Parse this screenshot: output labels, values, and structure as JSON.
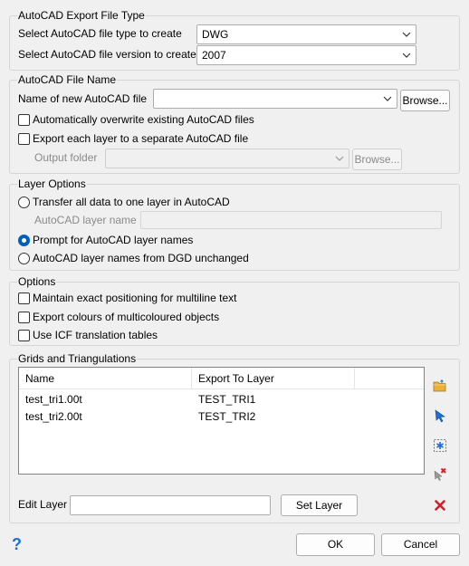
{
  "export_type": {
    "title": "AutoCAD Export File Type",
    "file_type_label": "Select AutoCAD file type to create",
    "file_type_value": "DWG",
    "version_label": "Select AutoCAD file version to create",
    "version_value": "2007"
  },
  "file_name": {
    "title": "AutoCAD File Name",
    "name_label": "Name of new AutoCAD file",
    "name_value": "",
    "browse_label": "Browse...",
    "overwrite_label": "Automatically overwrite existing AutoCAD files",
    "overwrite_checked": false,
    "separate_label": "Export each layer to a separate AutoCAD file",
    "separate_checked": false,
    "output_folder_label": "Output folder",
    "output_folder_value": "",
    "output_browse_label": "Browse..."
  },
  "layer_options": {
    "title": "Layer Options",
    "transfer_label": "Transfer all data to one layer in AutoCAD",
    "layer_name_label": "AutoCAD layer name",
    "layer_name_value": "",
    "prompt_label": "Prompt for AutoCAD layer names",
    "unchanged_label": "AutoCAD layer names from DGD unchanged",
    "selected": "prompt"
  },
  "options": {
    "title": "Options",
    "maintain_label": "Maintain exact positioning for multiline text",
    "colours_label": "Export colours of multicoloured objects",
    "icf_label": "Use ICF translation tables"
  },
  "grids": {
    "title": "Grids and Triangulations",
    "columns": [
      "Name",
      "Export To Layer"
    ],
    "rows": [
      {
        "name": "test_tri1.00t",
        "layer": "TEST_TRI1"
      },
      {
        "name": "test_tri2.00t",
        "layer": "TEST_TRI2"
      }
    ],
    "edit_layer_label": "Edit Layer",
    "edit_layer_value": "",
    "set_layer_label": "Set Layer"
  },
  "footer": {
    "help_icon": "?",
    "ok_label": "OK",
    "cancel_label": "Cancel"
  },
  "colors": {
    "accent": "#005fb8",
    "delete_red": "#d0202a",
    "folder_yellow": "#e8b23a"
  }
}
